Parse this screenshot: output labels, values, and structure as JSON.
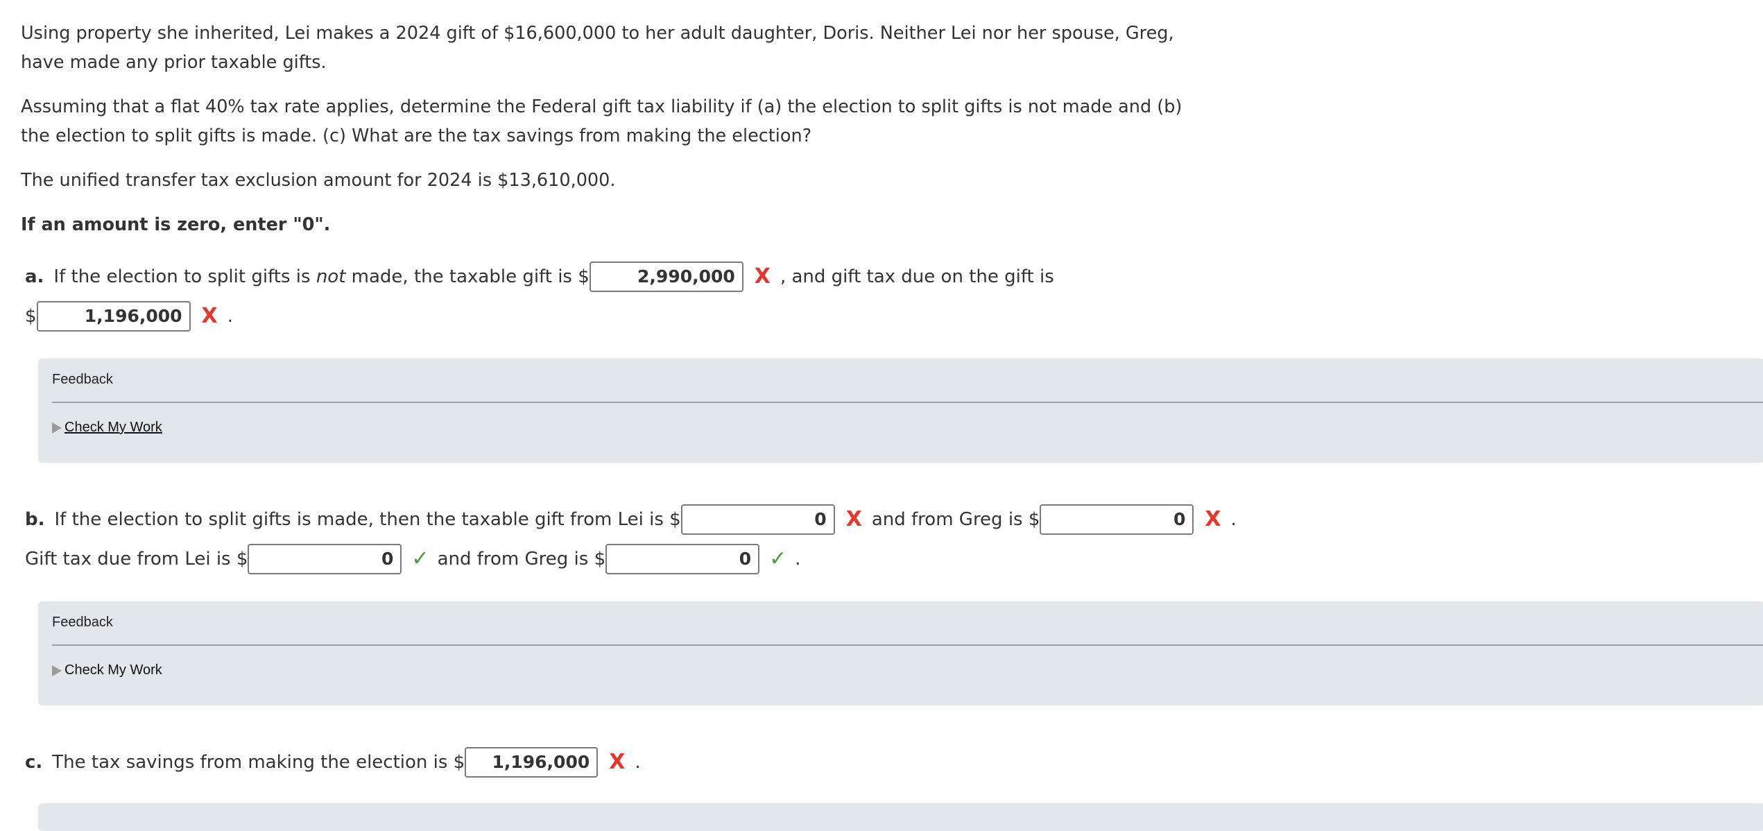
{
  "problem": {
    "p1": "Using property she inherited, Lei makes a 2024 gift of $16,600,000 to her adult daughter, Doris. Neither Lei nor her spouse, Greg, have made any prior taxable gifts.",
    "p2": "Assuming that a flat 40% tax rate applies, determine the Federal gift tax liability if (a) the election to split gifts is not made and (b) the election to split gifts is made. (c) What are the tax savings from making the election?",
    "p3": "The unified transfer tax exclusion amount for 2024 is $13,610,000.",
    "p4": "If an amount is zero, enter \"0\"."
  },
  "part_a": {
    "label": "a.",
    "text1": "If the election to split gifts is",
    "text_italic": "not",
    "text2": "made, the taxable gift is $",
    "taxable_gift": "2,990,000",
    "text3": ", and gift tax due on the gift is",
    "dollar": "$",
    "gift_tax": "1,196,000",
    "period": "."
  },
  "part_b": {
    "label": "b.",
    "text1": "If the election to split gifts is made, then the taxable gift from Lei is $",
    "lei_taxable": "0",
    "text2": "and from Greg is $",
    "greg_taxable": "0",
    "period": ".",
    "text3": "Gift tax due from Lei is $",
    "lei_tax": "0",
    "text4": "and from Greg is $",
    "greg_tax": "0"
  },
  "part_c": {
    "label": "c.",
    "text1": "The tax savings from making the election is $",
    "savings": "1,196,000",
    "period": "."
  },
  "feedback": {
    "title": "Feedback",
    "check_label": "Check My Work"
  },
  "marks": {
    "wrong": "X",
    "right": "✓",
    "wrong_color": "#e2382d",
    "right_color": "#4a9b3b"
  },
  "colors": {
    "feedback_bg": "#e1e7eb"
  }
}
